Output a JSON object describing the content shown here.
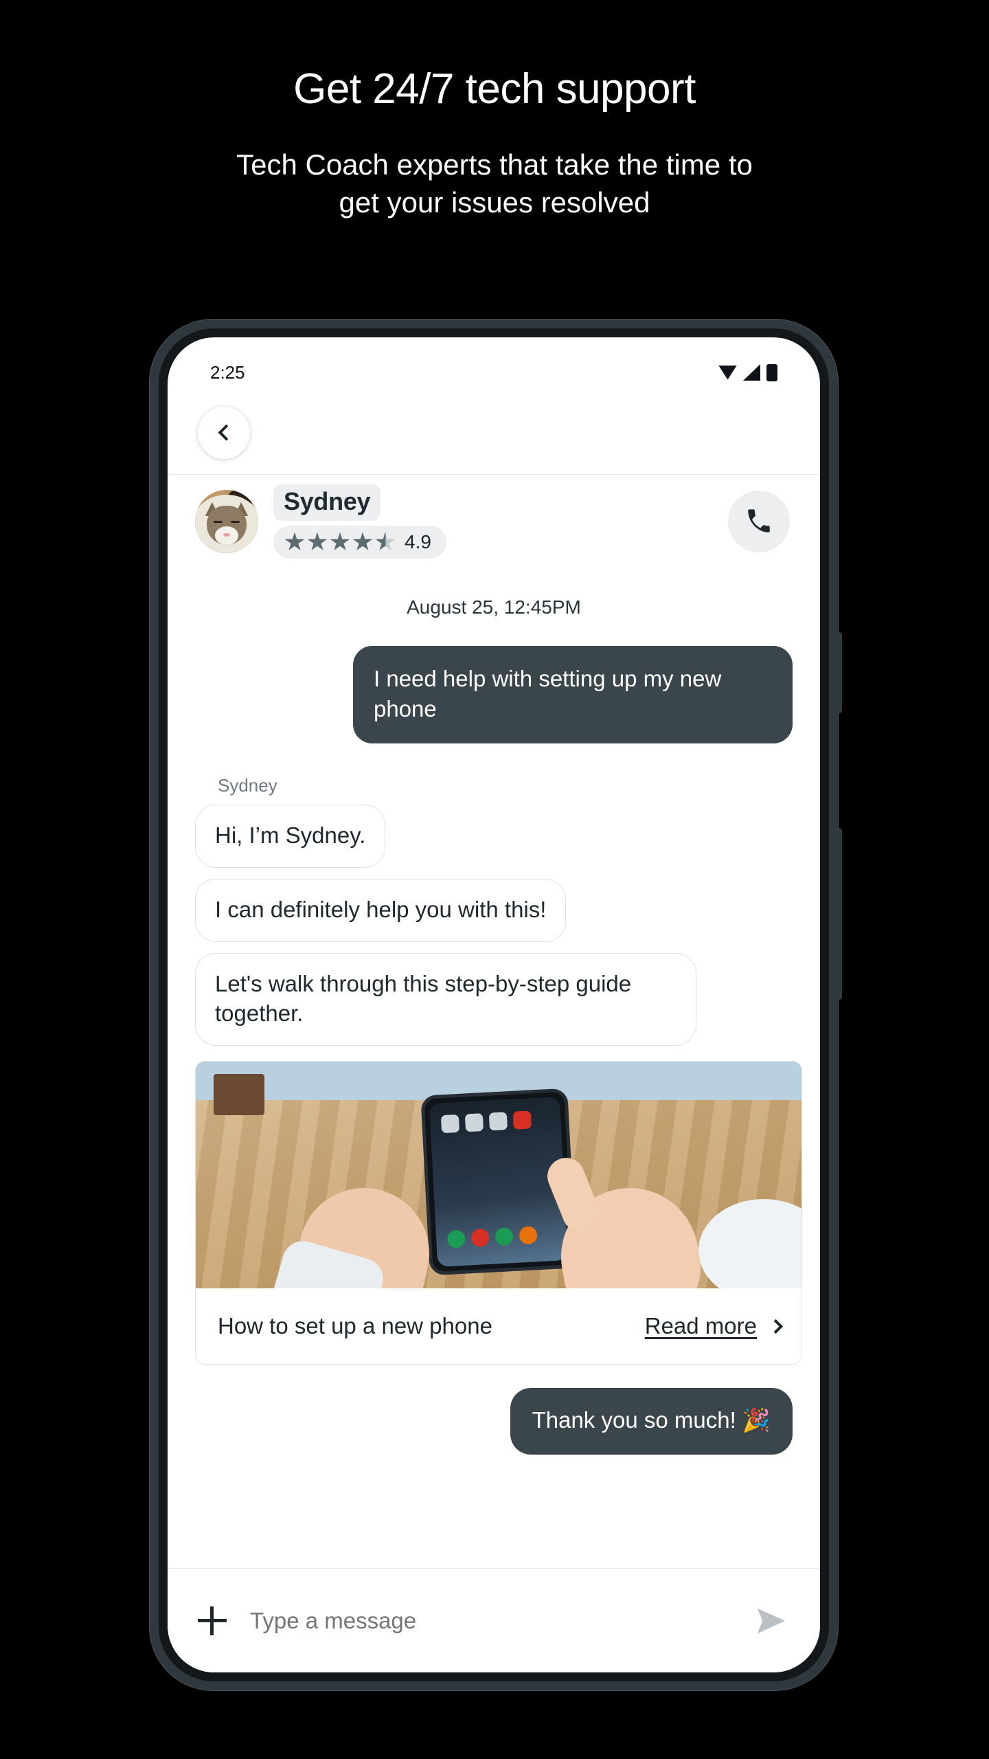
{
  "marketing": {
    "headline": "Get 24/7 tech support",
    "subhead_line1": "Tech Coach experts that take the time to",
    "subhead_line2": "get your issues resolved"
  },
  "phone": {
    "status_bar": {
      "time": "2:25",
      "icons": [
        "wifi-icon",
        "signal-icon",
        "battery-icon"
      ]
    },
    "nav": {
      "back_icon": "chevron-left-icon"
    },
    "agent_header": {
      "avatar_alt": "cat-avatar",
      "name": "Sydney",
      "rating_value": "4.9",
      "stars_filled": 4,
      "stars_half": 1,
      "stars_total": 5,
      "call_icon": "phone-icon"
    },
    "conversation": {
      "daystamp": "August 25, 12:45PM",
      "outgoing_1": "I need help with setting up my new phone",
      "sender_label": "Sydney",
      "incoming_1": "Hi, I’m Sydney.",
      "incoming_2": "I can definitely help you with this!",
      "incoming_3": "Let's walk through this step-by-step guide together.",
      "article_card": {
        "image_alt": "hands-holding-smartphone-photo",
        "title": "How to set up a new phone",
        "link_label": "Read more",
        "link_chevron": "chevron-right-icon"
      },
      "outgoing_2": "Thank you so much! 🎉"
    },
    "composer": {
      "attach_icon": "plus-icon",
      "input_value": "",
      "input_placeholder": "Type a message",
      "send_icon": "send-icon"
    }
  },
  "colors": {
    "page_background": "#000000",
    "outgoing_bubble": "#3b464c",
    "incoming_bubble": "#ffffff",
    "incoming_border": "#dfe2e4",
    "pill_background": "#eceef0",
    "star_filled": "#5d6b72",
    "text_primary": "#1f282d",
    "text_muted": "#717a80",
    "device_frame": "#2f383c"
  }
}
